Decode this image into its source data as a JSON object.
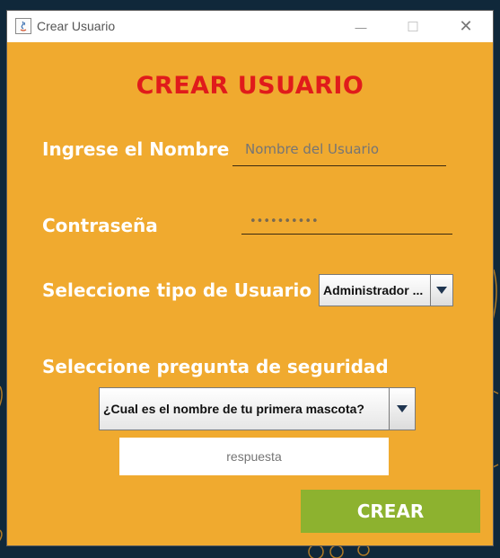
{
  "window": {
    "title": "Crear Usuario",
    "minimize": "—",
    "maximize": "☐",
    "close": "✕"
  },
  "form": {
    "heading": "CREAR USUARIO",
    "name_label": "Ingrese el Nombre",
    "name_placeholder": "Nombre del Usuario",
    "password_label": "Contraseña",
    "password_value": "••••••••••",
    "user_type_label": "Seleccione tipo de Usuario",
    "user_type_selected": "Administrador ...",
    "security_label": "Seleccione pregunta de seguridad",
    "security_selected": "¿Cual es el nombre de tu primera mascota?",
    "answer_placeholder": "respuesta",
    "create_label": "CREAR"
  },
  "colors": {
    "background": "#f0aa2f",
    "heading": "#e01b1b",
    "button": "#8db22f"
  }
}
